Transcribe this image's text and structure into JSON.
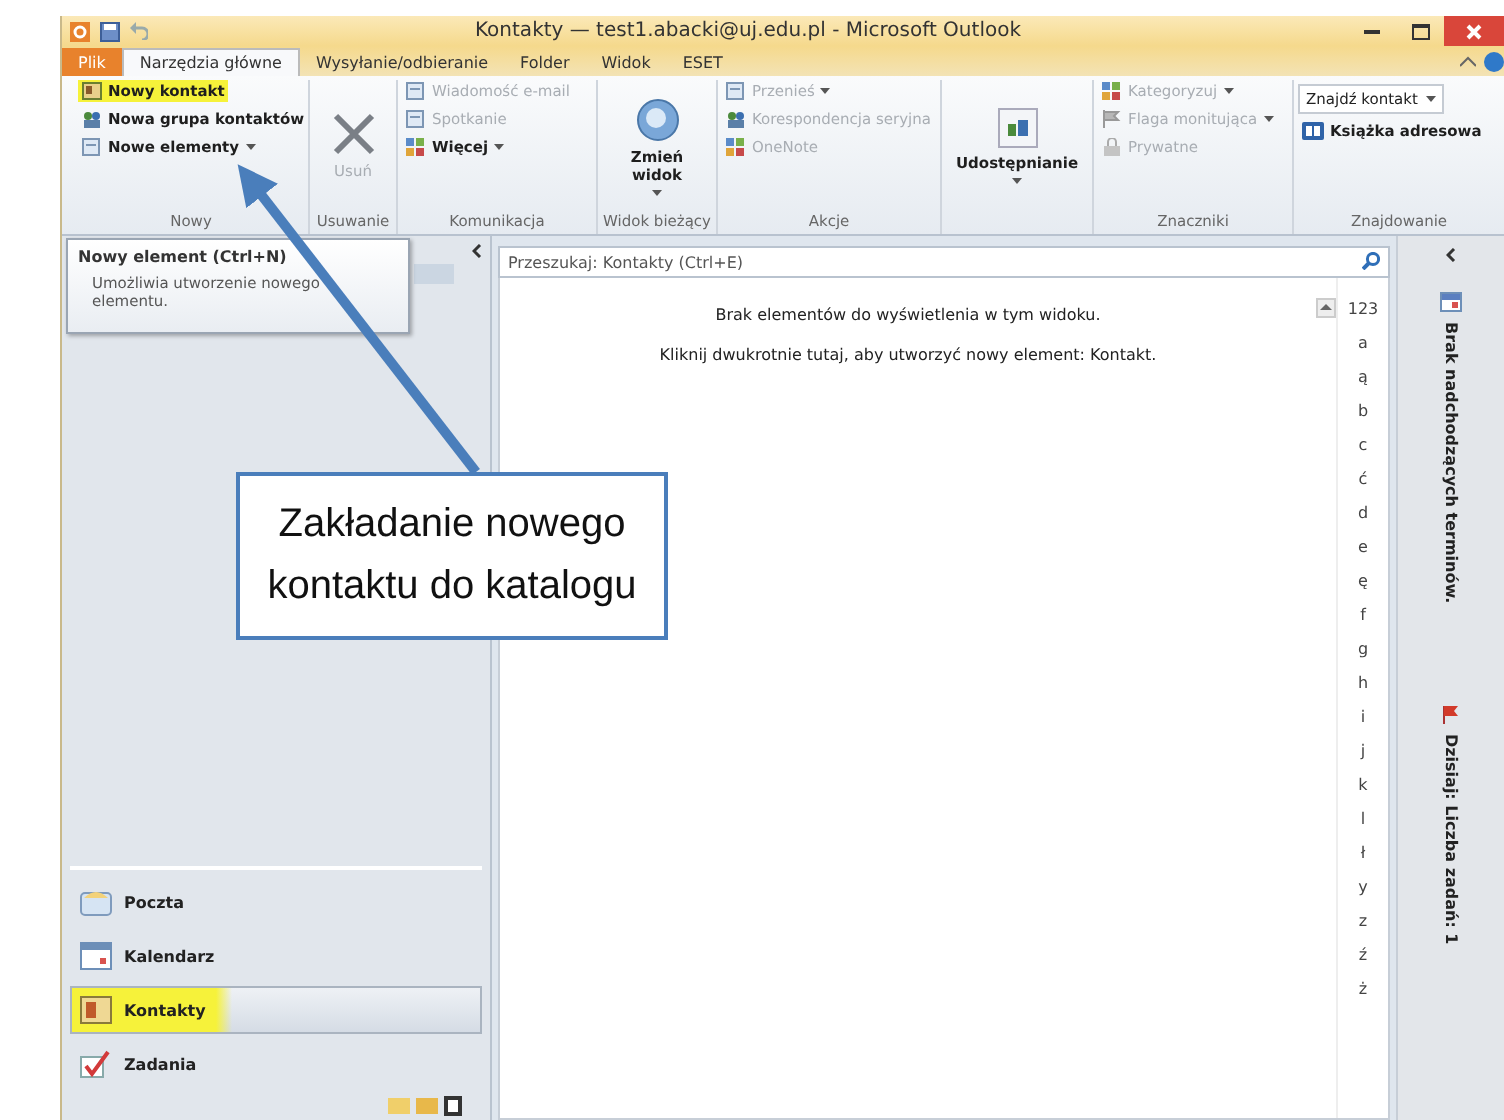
{
  "window": {
    "title": "Kontakty — test1.abacki@uj.edu.pl - Microsoft Outlook"
  },
  "tabs": [
    {
      "label": "Plik",
      "kind": "file",
      "selected": false
    },
    {
      "label": "Narzędzia główne",
      "kind": "tab",
      "selected": true
    },
    {
      "label": "Wysyłanie/odbieranie",
      "kind": "tab",
      "selected": false
    },
    {
      "label": "Folder",
      "kind": "tab",
      "selected": false
    },
    {
      "label": "Widok",
      "kind": "tab",
      "selected": false
    },
    {
      "label": "ESET",
      "kind": "tab",
      "selected": false
    }
  ],
  "ribbon": {
    "groups": [
      {
        "label": "Nowy",
        "items": [
          {
            "label": "Nowy kontakt",
            "kind": "small",
            "disabled": false,
            "highlighted": true
          },
          {
            "label": "Nowa grupa kontaktów",
            "kind": "small",
            "disabled": false
          },
          {
            "label": "Nowe elementy",
            "kind": "small",
            "disabled": false,
            "dropdown": true
          }
        ]
      },
      {
        "label": "Usuwanie",
        "items": [
          {
            "label": "Usuń",
            "kind": "large",
            "disabled": true
          }
        ]
      },
      {
        "label": "Komunikacja",
        "items": [
          {
            "label": "Wiadomość e-mail",
            "kind": "small",
            "disabled": true
          },
          {
            "label": "Spotkanie",
            "kind": "small",
            "disabled": true
          },
          {
            "label": "Więcej",
            "kind": "small",
            "disabled": false,
            "dropdown": true
          }
        ]
      },
      {
        "label": "Widok bieżący",
        "items": [
          {
            "label": "Zmień widok",
            "kind": "large",
            "disabled": false,
            "dropdown": true
          }
        ]
      },
      {
        "label": "Akcje",
        "items": [
          {
            "label": "Przenieś",
            "kind": "small",
            "disabled": true,
            "dropdown": true
          },
          {
            "label": "Korespondencja seryjna",
            "kind": "small",
            "disabled": true
          },
          {
            "label": "OneNote",
            "kind": "small",
            "disabled": true
          }
        ]
      },
      {
        "items": [
          {
            "label": "Udostępnianie",
            "kind": "large",
            "disabled": false,
            "dropdown": true
          }
        ]
      },
      {
        "label": "Znaczniki",
        "items": [
          {
            "label": "Kategoryzuj",
            "kind": "small",
            "disabled": true,
            "dropdown": true
          },
          {
            "label": "Flaga monitująca",
            "kind": "small",
            "disabled": true,
            "dropdown": true
          },
          {
            "label": "Prywatne",
            "kind": "small",
            "disabled": true
          }
        ]
      },
      {
        "label": "Znajdowanie",
        "items": [
          {
            "label": "Znajdź kontakt",
            "kind": "field",
            "dropdown": true
          },
          {
            "label": "Książka adresowa",
            "kind": "small",
            "disabled": false
          }
        ]
      }
    ]
  },
  "tooltip": {
    "title": "Nowy element (Ctrl+N)",
    "text": "Umożliwia utworzenie nowego elementu."
  },
  "navigation": [
    {
      "label": "Poczta",
      "selected": false
    },
    {
      "label": "Kalendarz",
      "selected": false
    },
    {
      "label": "Kontakty",
      "selected": true,
      "highlighted": true
    },
    {
      "label": "Zadania",
      "selected": false
    }
  ],
  "search": {
    "placeholder": "Przeszukaj: Kontakty (Ctrl+E)"
  },
  "messages": [
    "Brak elementów do wyświetlenia w tym widoku.",
    "Kliknij dwukrotnie tutaj, aby utworzyć nowy element: Kontakt."
  ],
  "index": [
    "123",
    "a",
    "ą",
    "b",
    "c",
    "ć",
    "d",
    "e",
    "ę",
    "f",
    "g",
    "h",
    "i",
    "j",
    "k",
    "l",
    "ł",
    "y",
    "z",
    "ź",
    "ż"
  ],
  "todo_bar": {
    "appointments": "Brak nadchodzących terminów.",
    "tasks": "Dzisiaj: Liczba zadań: 1"
  },
  "annotation": {
    "text": "Zakładanie nowego kontaktu do katalogu"
  }
}
